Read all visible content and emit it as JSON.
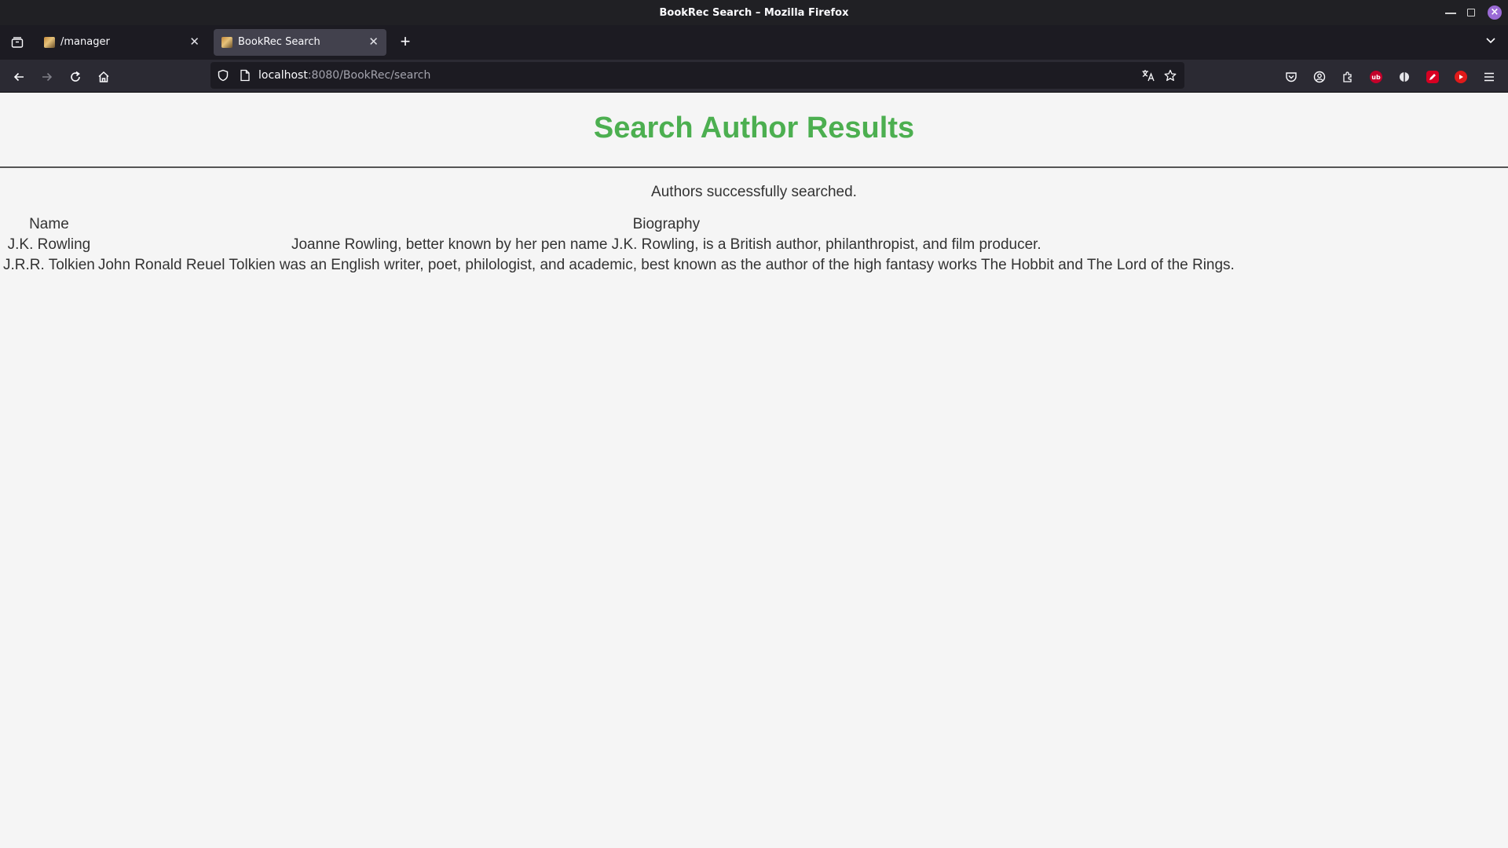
{
  "window": {
    "title": "BookRec Search – Mozilla Firefox"
  },
  "tabs": [
    {
      "label": "/manager",
      "active": false
    },
    {
      "label": "BookRec Search",
      "active": true
    }
  ],
  "urlbar": {
    "host": "localhost",
    "path": ":8080/BookRec/search"
  },
  "icons": {
    "back": "back-arrow-icon",
    "forward": "forward-arrow-icon",
    "reload": "reload-icon",
    "home": "home-icon",
    "extension_badge_1": "ub"
  },
  "colors": {
    "title_green": "#4caf50",
    "page_background": "#f5f5f5"
  },
  "page": {
    "title": "Search Author Results",
    "status": "Authors successfully searched.",
    "table": {
      "headers": [
        "Name",
        "Biography"
      ],
      "rows": [
        [
          "J.K. Rowling",
          "Joanne Rowling, better known by her pen name J.K. Rowling, is a British author, philanthropist, and film producer."
        ],
        [
          "J.R.R. Tolkien",
          "John Ronald Reuel Tolkien was an English writer, poet, philologist, and academic, best known as the author of the high fantasy works The Hobbit and The Lord of the Rings."
        ]
      ]
    }
  }
}
